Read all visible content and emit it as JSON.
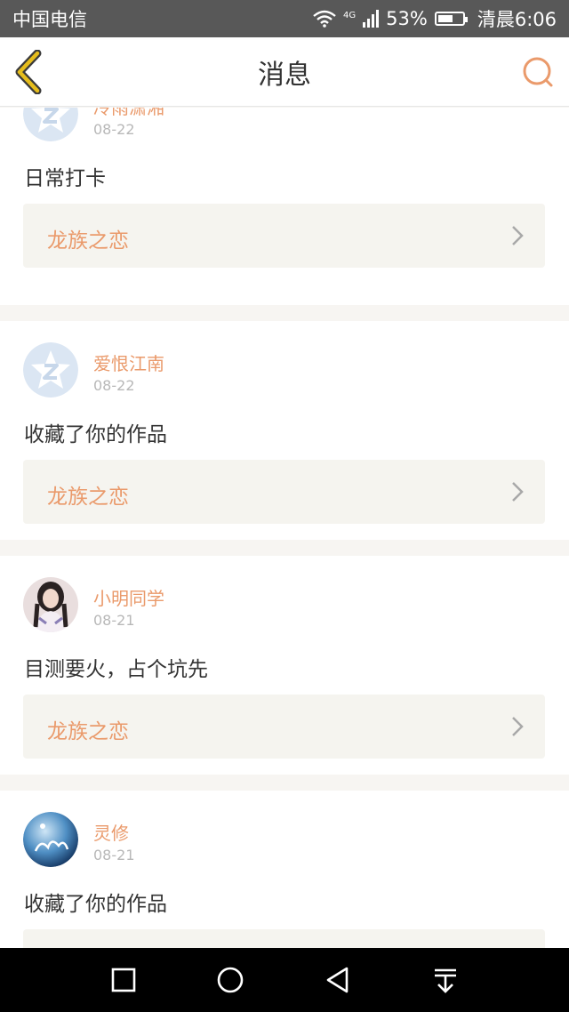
{
  "status_bar": {
    "carrier": "中国电信",
    "network": "4G",
    "battery": "53%",
    "battery_level": 0.53,
    "time": "清晨6:06",
    "icons": [
      "wifi-icon",
      "signal-icon",
      "battery-icon"
    ]
  },
  "header": {
    "title": "消息",
    "back_icon": "chevron-left-icon",
    "search_icon": "search-icon"
  },
  "colors": {
    "accent": "#ea9a6b",
    "back_yellow": "#c8a218",
    "work_bg": "#f5f4ef",
    "gap_bg": "#f7f5f2"
  },
  "messages": [
    {
      "name": "冷雨潇湘",
      "date": "08-22",
      "text": "日常打卡",
      "work": "龙族之恋",
      "avatar": "default-avatar-icon"
    },
    {
      "name": "爱恨江南",
      "date": "08-22",
      "text": "收藏了你的作品",
      "work": "龙族之恋",
      "avatar": "default-avatar-icon"
    },
    {
      "name": "小明同学",
      "date": "08-21",
      "text": "目测要火，占个坑先",
      "work": "龙族之恋",
      "avatar": "photo-avatar"
    },
    {
      "name": "灵修",
      "date": "08-21",
      "text": "收藏了你的作品",
      "work": "",
      "avatar": "art-avatar"
    }
  ],
  "system_nav": [
    "recent-apps-icon",
    "home-icon",
    "back-icon",
    "notification-pull-icon"
  ]
}
